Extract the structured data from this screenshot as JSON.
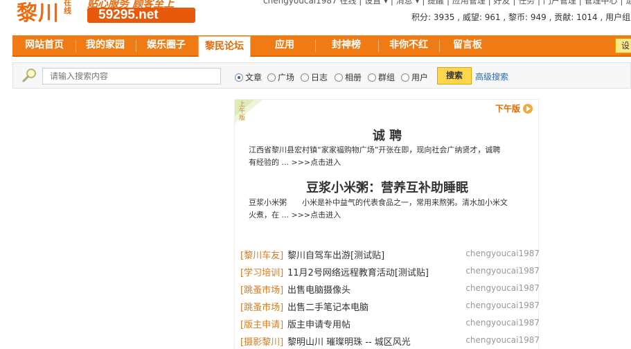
{
  "header": {
    "logo_main": "黎川",
    "logo_small": "在线",
    "slogan": "贴心服务 顾客至上",
    "url": "59295.net",
    "topline": "chengyoucai1987 在线 | 设置 ▾ | 消息 ▾ | 提醒 | 应用管理 | 好友 | 任务 | 门户管理 | 管理中心 | 退出",
    "user_stats": "积分: 3935 , 威望: 961 , 黎币: 949 , 贡献: 1014 , 用户组: 管理"
  },
  "nav": {
    "items": [
      {
        "label": "网站首页",
        "active": false
      },
      {
        "label": "我的家园",
        "active": false
      },
      {
        "label": "娱乐圈子",
        "active": false
      },
      {
        "label": "黎民论坛",
        "active": true
      },
      {
        "label": "应用",
        "active": false
      },
      {
        "label": "封神榜",
        "active": false
      },
      {
        "label": "非你不红",
        "active": false
      },
      {
        "label": "留言板",
        "active": false
      }
    ],
    "right_button": "设"
  },
  "search": {
    "placeholder": "请输入搜索内容",
    "options": [
      {
        "label": "文章",
        "selected": true
      },
      {
        "label": "广场",
        "selected": false
      },
      {
        "label": "日志",
        "selected": false
      },
      {
        "label": "相册",
        "selected": false
      },
      {
        "label": "群组",
        "selected": false
      },
      {
        "label": "用户",
        "selected": false
      }
    ],
    "button": "搜索",
    "advanced": "高级搜索"
  },
  "feature": {
    "corner_label": "上午版",
    "next_tab": "下午版",
    "articles": [
      {
        "title": "诚 聘",
        "line1": "江西省黎川县宏村镇“家家福购物广场”开张在即，现向社会广纳贤才，诚聘",
        "line2": "有经验的 ...",
        "more": ">>>点击进入"
      },
      {
        "title": "豆浆小米粥：营养互补助睡眠",
        "line1": "豆浆小米粥　　小米是补中益气的代表食品之一，常用来熬粥。清水加小米文",
        "line2": "火煮，在 ...",
        "more": ">>>点击进入"
      }
    ]
  },
  "threads": [
    {
      "category": "[黎川车友]",
      "title": "黎川自驾车出游[测试贴]",
      "author": "chengyoucai1987"
    },
    {
      "category": "[学习培训]",
      "title": "11月2号网络远程教育活动[测试贴]",
      "author": "chengyoucai1987"
    },
    {
      "category": "[跳蚤市场]",
      "title": "出售电脑摄像头",
      "author": "chengyoucai1987"
    },
    {
      "category": "[跳蚤市场]",
      "title": "出售二手笔记本电脑",
      "author": "chengyoucai1987"
    },
    {
      "category": "[版主申请]",
      "title": "版主申请专用帖",
      "author": "chengyoucai1987"
    },
    {
      "category": "[摄影黎川]",
      "title": "黎明山川 璀璨明珠 -- 城区风光",
      "author": "chengyoucai1987"
    }
  ],
  "colors": {
    "brand_orange": "#f07b14",
    "category_orange": "#dd7a1c",
    "link_blue": "#2a6ab0"
  }
}
